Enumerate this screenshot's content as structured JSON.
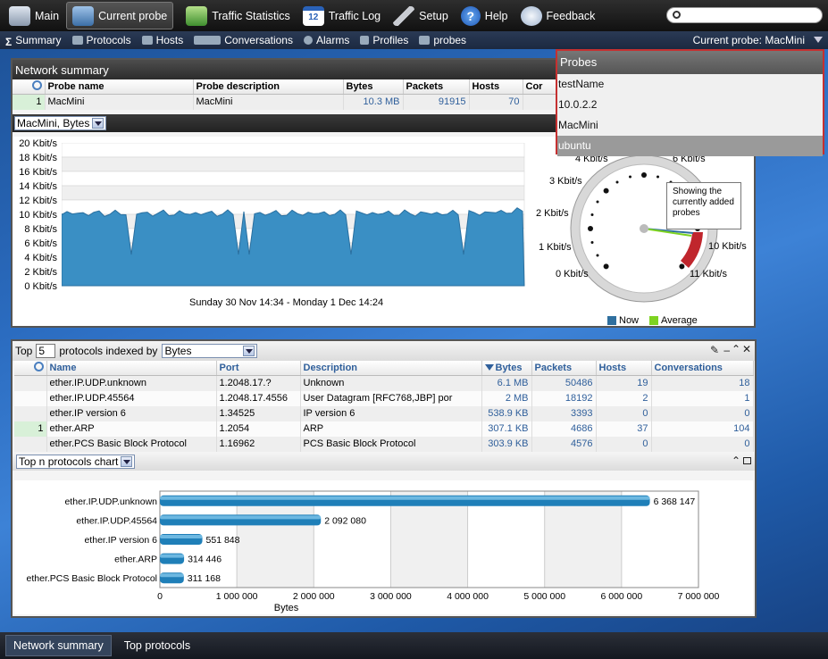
{
  "topbar": {
    "items": [
      {
        "label": "Main",
        "icon": "home-icon",
        "active": false
      },
      {
        "label": "Current probe",
        "icon": "probe-icon",
        "active": true
      },
      {
        "label": "Traffic Statistics",
        "icon": "chart-icon",
        "active": false
      },
      {
        "label": "Traffic Log",
        "icon": "calendar-icon",
        "active": false
      },
      {
        "label": "Setup",
        "icon": "wrench-icon",
        "active": false
      },
      {
        "label": "Help",
        "icon": "help-icon",
        "active": false
      },
      {
        "label": "Feedback",
        "icon": "speech-bubble-icon",
        "active": false
      }
    ],
    "calendar_day": "12",
    "search_placeholder": ""
  },
  "subbar": {
    "items": [
      {
        "label": "Summary"
      },
      {
        "label": "Protocols"
      },
      {
        "label": "Hosts"
      },
      {
        "label": "Conversations"
      },
      {
        "label": "Alarms"
      },
      {
        "label": "Profiles"
      },
      {
        "label": "probes"
      }
    ],
    "current_probe": "Current probe: MacMini"
  },
  "network_summary": {
    "title": "Network summary",
    "columns": [
      "Probe name",
      "Probe description",
      "Bytes",
      "Packets",
      "Hosts",
      "Cor"
    ],
    "rows": [
      {
        "index": "1",
        "name": "MacMini",
        "description": "MacMini",
        "bytes": "10.3 MB",
        "packets": "91915",
        "hosts": "70"
      }
    ],
    "selector": "MacMini, Bytes",
    "time_range": "Sunday 30 Nov 14:34 - Monday 1 Dec 14:24",
    "y_ticks": [
      "20 Kbit/s",
      "18 Kbit/s",
      "16 Kbit/s",
      "14 Kbit/s",
      "12 Kbit/s",
      "10 Kbit/s",
      "8 Kbit/s",
      "6 Kbit/s",
      "4 Kbit/s",
      "2 Kbit/s",
      "0 Kbit/s"
    ],
    "gauge_labels": [
      "0 Kbit/s",
      "1 Kbit/s",
      "2 Kbit/s",
      "3 Kbit/s",
      "4 Kbit/s",
      "6 Kbit/s",
      "10 Kbit/s",
      "11 Kbit/s"
    ],
    "legend": {
      "now": "Now",
      "average": "Average"
    },
    "colors": {
      "area": "#3a8fc4",
      "now": "#2f6f9f",
      "average": "#7ed321"
    }
  },
  "probes_dropdown": {
    "title": "Probes",
    "items": [
      "testName",
      "10.0.2.2",
      "MacMini",
      "ubuntu"
    ],
    "selected": "ubuntu",
    "tooltip": "Showing the currently added probes"
  },
  "top_protocols": {
    "top_label": "Top",
    "top_value": "5",
    "indexed_label": "protocols indexed by",
    "indexed_by": "Bytes",
    "columns": [
      "Name",
      "Port",
      "Description",
      "Bytes",
      "Packets",
      "Hosts",
      "Conversations"
    ],
    "rows": [
      {
        "index": "",
        "name": "ether.IP.UDP.unknown",
        "port": "1.2048.17.?",
        "description": "Unknown",
        "bytes": "6.1 MB",
        "packets": "50486",
        "hosts": "19",
        "conversations": "18"
      },
      {
        "index": "",
        "name": "ether.IP.UDP.45564",
        "port": "1.2048.17.4556",
        "description": "User Datagram [RFC768,JBP] por",
        "bytes": "2 MB",
        "packets": "18192",
        "hosts": "2",
        "conversations": "1"
      },
      {
        "index": "",
        "name": "ether.IP version 6",
        "port": "1.34525",
        "description": "IP version 6",
        "bytes": "538.9 KB",
        "packets": "3393",
        "hosts": "0",
        "conversations": "0"
      },
      {
        "index": "1",
        "name": "ether.ARP",
        "port": "1.2054",
        "description": "ARP",
        "bytes": "307.1 KB",
        "packets": "4686",
        "hosts": "37",
        "conversations": "104"
      },
      {
        "index": "",
        "name": "ether.PCS Basic Block Protocol",
        "port": "1.16962",
        "description": "PCS Basic Block Protocol",
        "bytes": "303.9 KB",
        "packets": "4576",
        "hosts": "0",
        "conversations": "0"
      }
    ],
    "chart_selector": "Top n protocols chart"
  },
  "chart_data": {
    "type": "bar",
    "orientation": "horizontal",
    "categories": [
      "ether.IP.UDP.unknown",
      "ether.IP.UDP.45564",
      "ether.IP version 6",
      "ether.ARP",
      "ether.PCS Basic Block Protocol"
    ],
    "values": [
      6368147,
      2092080,
      551848,
      314446,
      311168
    ],
    "value_labels": [
      "6 368 147",
      "2 092 080",
      "551 848",
      "314 446",
      "311 168"
    ],
    "xlabel": "Bytes",
    "xlim": [
      0,
      7000000
    ],
    "x_ticks": [
      "0",
      "1 000 000",
      "2 000 000",
      "3 000 000",
      "4 000 000",
      "5 000 000",
      "6 000 000",
      "7 000 000"
    ],
    "grid": true,
    "color": "#1f7fb8"
  },
  "footer": {
    "tabs": [
      {
        "label": "Network summary",
        "active": true
      },
      {
        "label": "Top protocols",
        "active": false
      }
    ]
  }
}
